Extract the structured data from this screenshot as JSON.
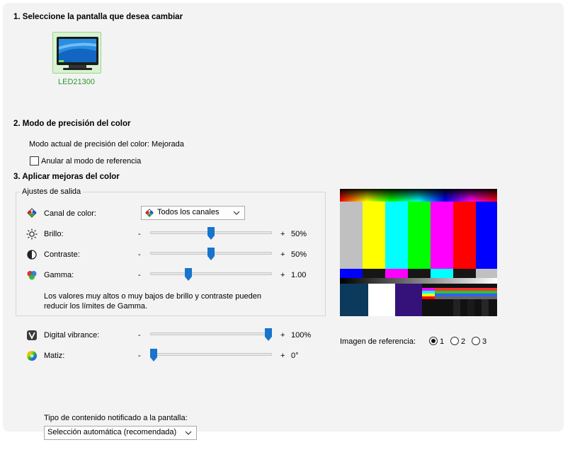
{
  "section1": {
    "title": "1. Seleccione la pantalla que desea cambiar",
    "display_name": "LED21300"
  },
  "section2": {
    "title": "2. Modo de precisión del color",
    "current_mode": "Modo actual de precisión del color: Mejorada",
    "override_label": "Anular al modo de referencia"
  },
  "section3": {
    "title": "3. Aplicar mejoras del color",
    "output_group": "Ajustes de salida",
    "channel_label": "Canal de color:",
    "channel_value": "Todos los canales",
    "brightness_label": "Brillo:",
    "brightness_value": "50%",
    "contrast_label": "Contraste:",
    "contrast_value": "50%",
    "gamma_label": "Gamma:",
    "gamma_value": "1.00",
    "note_line1": "Los valores muy altos o muy bajos de brillo y contraste pueden",
    "note_line2": "reducir los límites de Gamma.",
    "vibrance_label": "Digital vibrance:",
    "vibrance_value": "100%",
    "hue_label": "Matiz:",
    "hue_value": "0°",
    "minus": "-",
    "plus": "+"
  },
  "levels": {
    "brightness": 0.5,
    "contrast": 0.5,
    "gamma": 0.3,
    "vibrance": 1.0,
    "hue": 0.0
  },
  "reference": {
    "label": "Imagen de referencia:",
    "options": [
      "1",
      "2",
      "3"
    ],
    "selected": "1"
  },
  "content_type": {
    "label": "Tipo de contenido notificado a la pantalla:",
    "value": "Selección automática (recomendada)"
  }
}
